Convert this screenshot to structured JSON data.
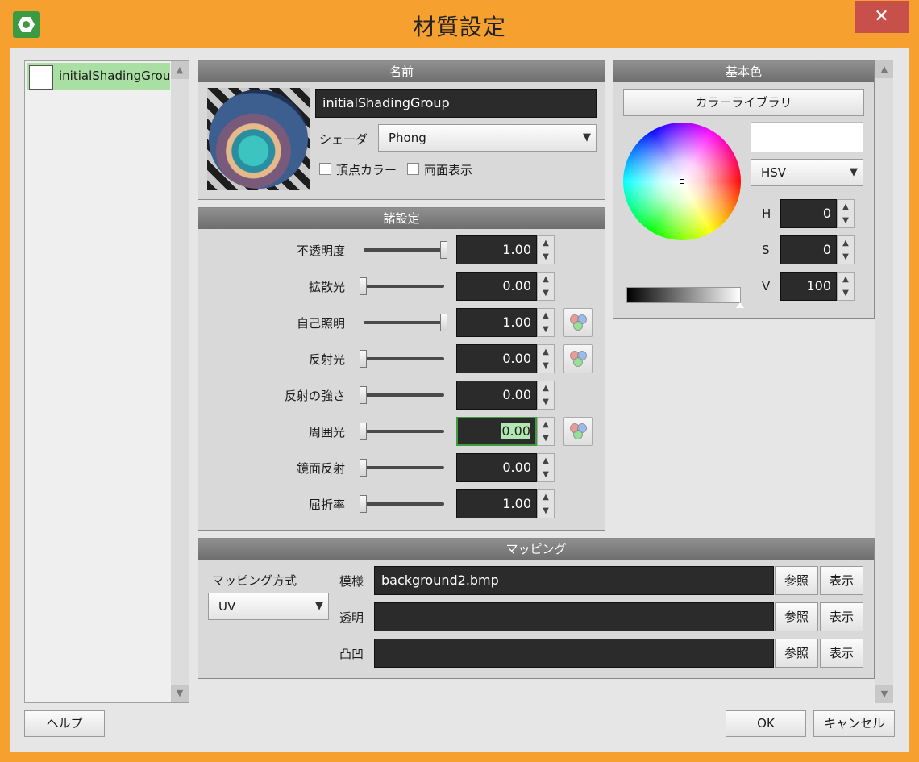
{
  "window": {
    "title": "材質設定",
    "close_glyph": "✕"
  },
  "material_list": {
    "items": [
      {
        "name": "initialShadingGroup",
        "color": "#ffffff"
      }
    ]
  },
  "name_panel": {
    "header": "名前",
    "name_value": "initialShadingGroup",
    "shader_label": "シェーダ",
    "shader_value": "Phong",
    "vertex_color_label": "頂点カラー",
    "double_sided_label": "両面表示"
  },
  "settings_panel": {
    "header": "諸設定",
    "rows": [
      {
        "label": "不透明度",
        "value": "1.00",
        "level": 1.0,
        "texture_button": false
      },
      {
        "label": "拡散光",
        "value": "0.00",
        "level": 0.0,
        "texture_button": false
      },
      {
        "label": "自己照明",
        "value": "1.00",
        "level": 1.0,
        "texture_button": true
      },
      {
        "label": "反射光",
        "value": "0.00",
        "level": 0.0,
        "texture_button": true
      },
      {
        "label": "反射の強さ",
        "value": "0.00",
        "level": 0.0,
        "texture_button": false
      },
      {
        "label": "周囲光",
        "value": "0.00",
        "level": 0.0,
        "texture_button": true,
        "active": true
      },
      {
        "label": "鏡面反射",
        "value": "0.00",
        "level": 0.0,
        "texture_button": false
      },
      {
        "label": "屈折率",
        "value": "1.00",
        "level": 0.0,
        "texture_button": false
      }
    ]
  },
  "base_color_panel": {
    "header": "基本色",
    "library_button": "カラーライブラリ",
    "mode_value": "HSV",
    "preview_color": "#ffffff",
    "h_label": "H",
    "h_value": "0",
    "s_label": "S",
    "s_value": "0",
    "v_label": "V",
    "v_value": "100"
  },
  "mapping_panel": {
    "header": "マッピング",
    "method_label": "マッピング方式",
    "method_value": "UV",
    "rows": [
      {
        "label": "模様",
        "value": "background2.bmp"
      },
      {
        "label": "透明",
        "value": ""
      },
      {
        "label": "凸凹",
        "value": ""
      }
    ],
    "browse_label": "参照",
    "show_label": "表示"
  },
  "footer": {
    "help_label": "ヘルプ",
    "ok_label": "OK",
    "cancel_label": "キャンセル"
  },
  "colors": {
    "frame": "#f6a12f",
    "close": "#c7504a",
    "selection": "#a9dfa3",
    "panel_header": "#7d7d7d"
  }
}
